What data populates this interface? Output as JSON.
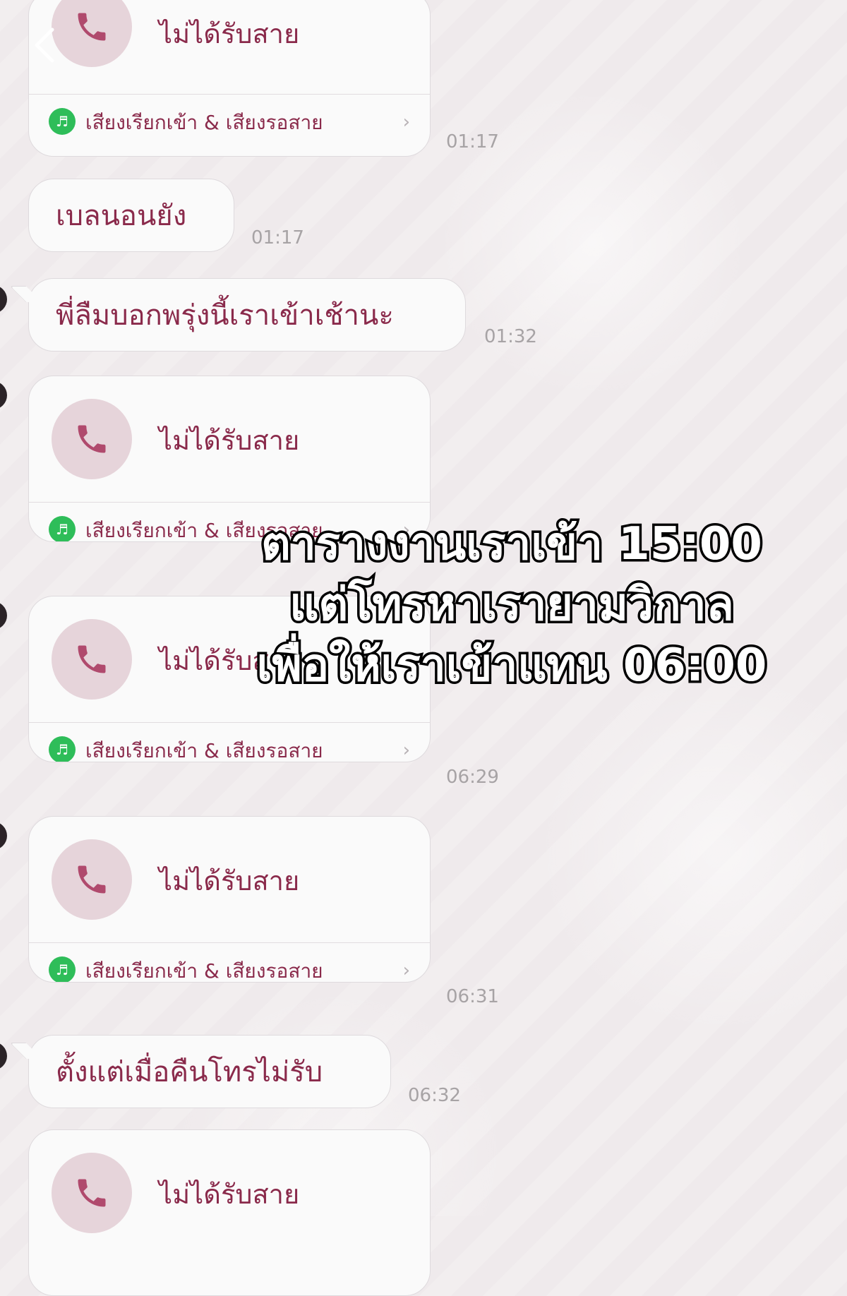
{
  "nav": {
    "back_icon": "chevron-left-icon"
  },
  "labels": {
    "missed_call": "ไม่ได้รับสาย",
    "ringback": "เสียงเรียกเข้า & เสียงรอสาย",
    "chevron": "›",
    "music_icon": "♬"
  },
  "messages": [
    {
      "type": "call",
      "time": "01:17"
    },
    {
      "type": "text",
      "text": "เบลนอนยัง",
      "time": "01:17"
    },
    {
      "type": "text",
      "text": "พี่ลืมบอกพรุ่งนี้เราเข้าเช้านะ",
      "time": "01:32"
    },
    {
      "type": "call",
      "time": ""
    },
    {
      "type": "call",
      "time": "06:29"
    },
    {
      "type": "call",
      "time": "06:31"
    },
    {
      "type": "text",
      "text": "ตั้งแต่เมื่อคืนโทรไม่รับ",
      "time": "06:32"
    },
    {
      "type": "call",
      "time": ""
    }
  ],
  "overlay": {
    "line1": "ตารางงานเราเข้า 15:00",
    "line2": "แต่โทรหาเรายามวิกาล",
    "line3": "เพื่อให้เราเข้าแทน 06:00"
  },
  "colors": {
    "accent_text": "#8a2a4b",
    "phone_circle": "#e6d4da",
    "music_green": "#2ebd59",
    "background": "#efeaec"
  }
}
